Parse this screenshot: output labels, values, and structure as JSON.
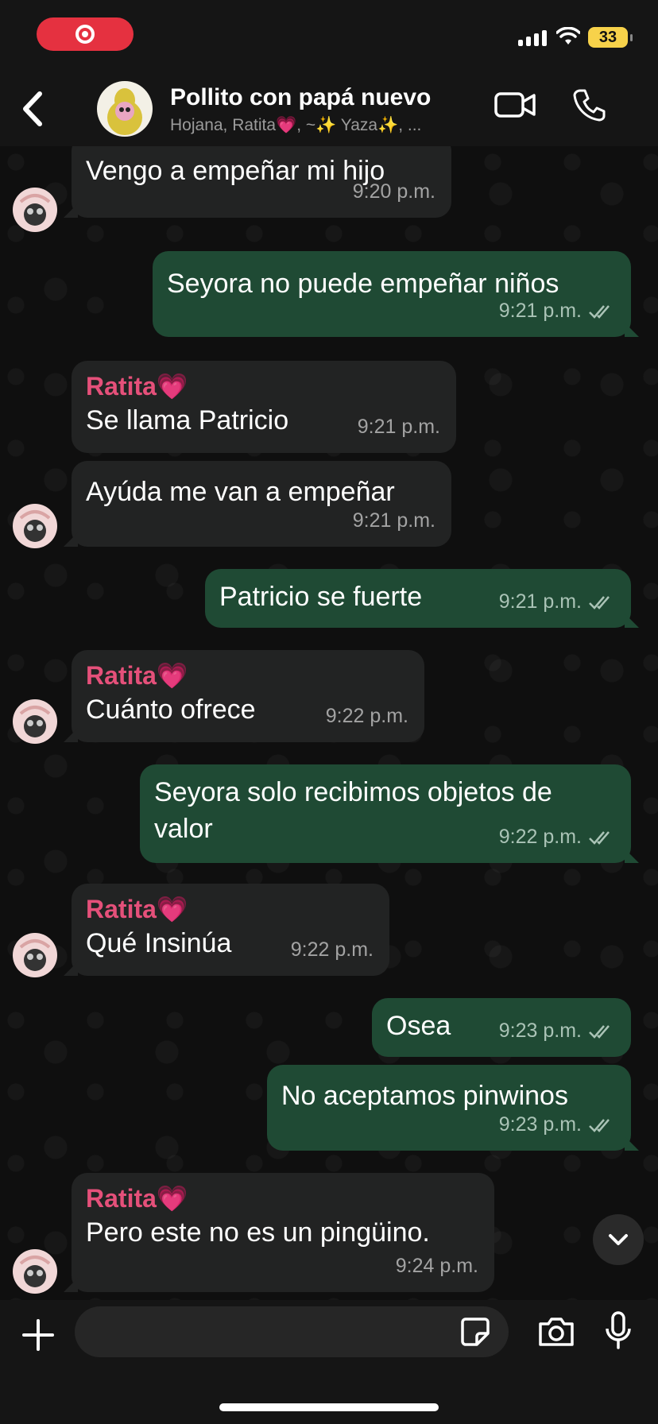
{
  "status_bar": {
    "battery": "33"
  },
  "header": {
    "title": "Pollito con papá nuevo",
    "members": "Hojana, Ratita💗, ~✨ Yaza✨, ..."
  },
  "messages": [
    {
      "text": "Vengo a empeñar  mi hijo",
      "time": "9:20 p.m."
    },
    {
      "text": "Seyora no puede empeñar niños",
      "time": "9:21 p.m."
    },
    {
      "sender": "Ratita💗",
      "text": "Se llama Patricio",
      "time": "9:21 p.m."
    },
    {
      "text": "Ayúda me van a empeñar",
      "time": "9:21 p.m."
    },
    {
      "text": "Patricio se fuerte",
      "time": "9:21 p.m."
    },
    {
      "sender": "Ratita💗",
      "text": "Cuánto ofrece",
      "time": "9:22 p.m."
    },
    {
      "text": "Seyora solo recibimos objetos de valor",
      "time": "9:22 p.m."
    },
    {
      "sender": "Ratita💗",
      "text": "Qué Insinúa",
      "time": "9:22 p.m."
    },
    {
      "text": "Osea",
      "time": "9:23 p.m."
    },
    {
      "text": "No aceptamos pinwinos",
      "time": "9:23 p.m."
    },
    {
      "sender": "Ratita💗",
      "text": "Pero este no es un pingüino.",
      "time": "9:24 p.m."
    }
  ],
  "input": {
    "placeholder": ""
  },
  "colors": {
    "outgoing": "#1f4a34",
    "incoming": "#222323",
    "sender_name": "#e5507a",
    "ticks": "#53bdeb"
  }
}
